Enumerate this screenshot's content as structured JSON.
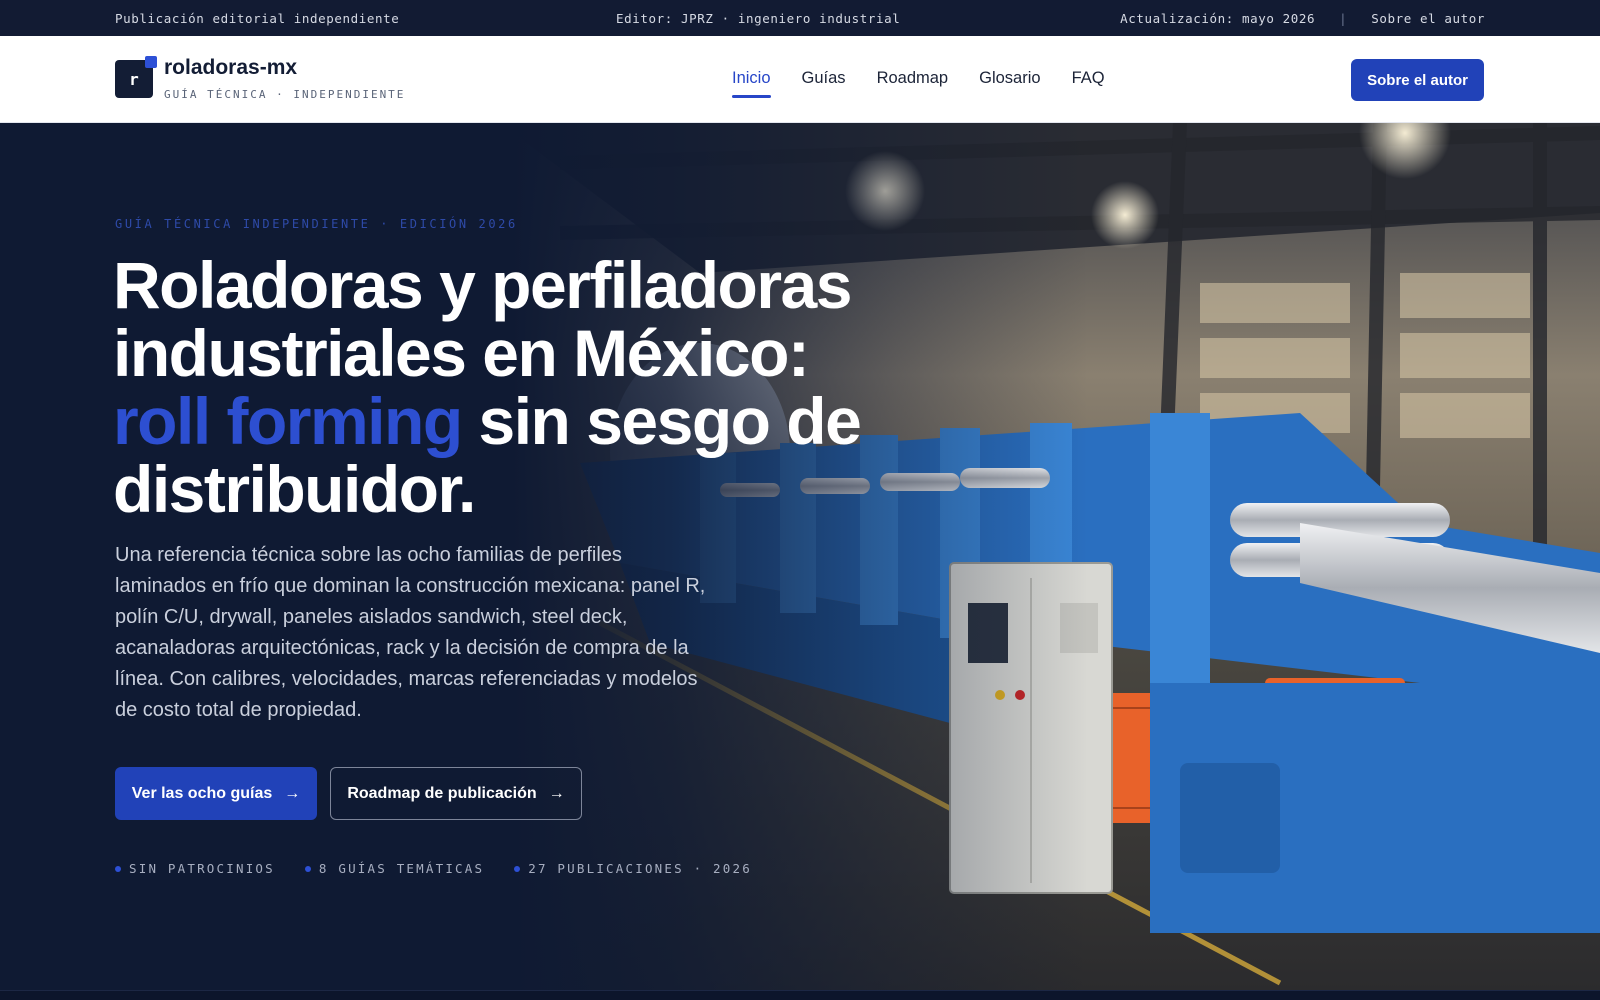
{
  "topbar": {
    "left": "Publicación editorial independiente",
    "center": "Editor: JPRZ · ingeniero industrial",
    "update": "Actualización: mayo 2026",
    "separator": "|",
    "about": "Sobre el autor"
  },
  "header": {
    "logo_letter": "r",
    "brand": "roladoras-mx",
    "brand_sub": "GUÍA TÉCNICA · INDEPENDIENTE",
    "nav": [
      "Inicio",
      "Guías",
      "Roadmap",
      "Glosario",
      "FAQ"
    ],
    "active_nav": "Inicio",
    "cta": "Sobre el autor"
  },
  "hero": {
    "eyebrow": "GUÍA TÉCNICA INDEPENDIENTE · EDICIÓN 2026",
    "headline_part1": "Roladoras y perfiladoras industriales en México:",
    "headline_accent": "roll forming",
    "headline_part2": "sin sesgo de distribuidor.",
    "lede": "Una referencia técnica sobre las ocho familias de perfiles laminados en frío que dominan la construcción mexicana: panel R, polín C/U, drywall, paneles aislados sandwich, steel deck, acanaladoras arquitectónicas, rack y la decisión de compra de la línea. Con calibres, velocidades, marcas referenciadas y modelos de costo total de propiedad.",
    "primary_button": "Ver las ocho guías",
    "secondary_button": "Roadmap de publicación",
    "arrow": "→",
    "stats": [
      "SIN PATROCINIOS",
      "8 GUÍAS TEMÁTICAS",
      "27 PUBLICACIONES · 2026"
    ],
    "image_description_icon": "factory-photo"
  },
  "colors": {
    "navy": "#0f1a33",
    "accent_blue": "#2142b8",
    "machine_blue": "#2a6fc0",
    "guard_orange": "#e8622a"
  }
}
